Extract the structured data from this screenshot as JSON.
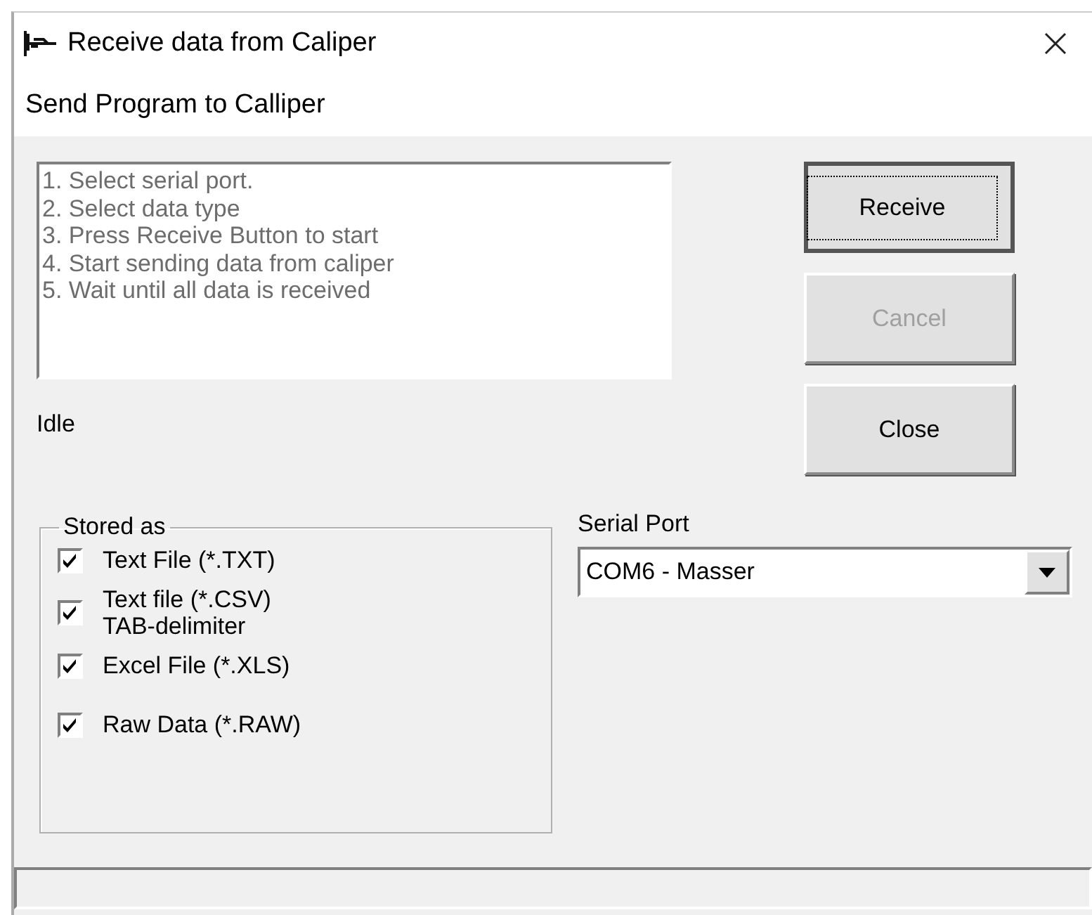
{
  "window": {
    "title": "Receive data from Caliper"
  },
  "menu": [
    "Send Program to Calliper"
  ],
  "instructions": [
    "1. Select serial port.",
    "2. Select data type",
    "3. Press Receive Button to start",
    "4. Start sending data from caliper",
    "5. Wait until all data is received"
  ],
  "status": "Idle",
  "buttons": [
    {
      "label": "Receive",
      "default": true,
      "disabled": false
    },
    {
      "label": "Cancel",
      "default": false,
      "disabled": true
    },
    {
      "label": "Close",
      "default": false,
      "disabled": false
    }
  ],
  "stored_as": {
    "title": "Stored as",
    "options": [
      {
        "label": "Text File (*.TXT)",
        "checked": true
      },
      {
        "label": "Text file (*.CSV)\nTAB-delimiter",
        "checked": true
      },
      {
        "label": "Excel File (*.XLS)",
        "checked": true
      },
      {
        "label": "Raw Data (*.RAW)",
        "checked": true
      }
    ]
  },
  "serial_port": {
    "label": "Serial Port",
    "value": "COM6 - Masser"
  }
}
